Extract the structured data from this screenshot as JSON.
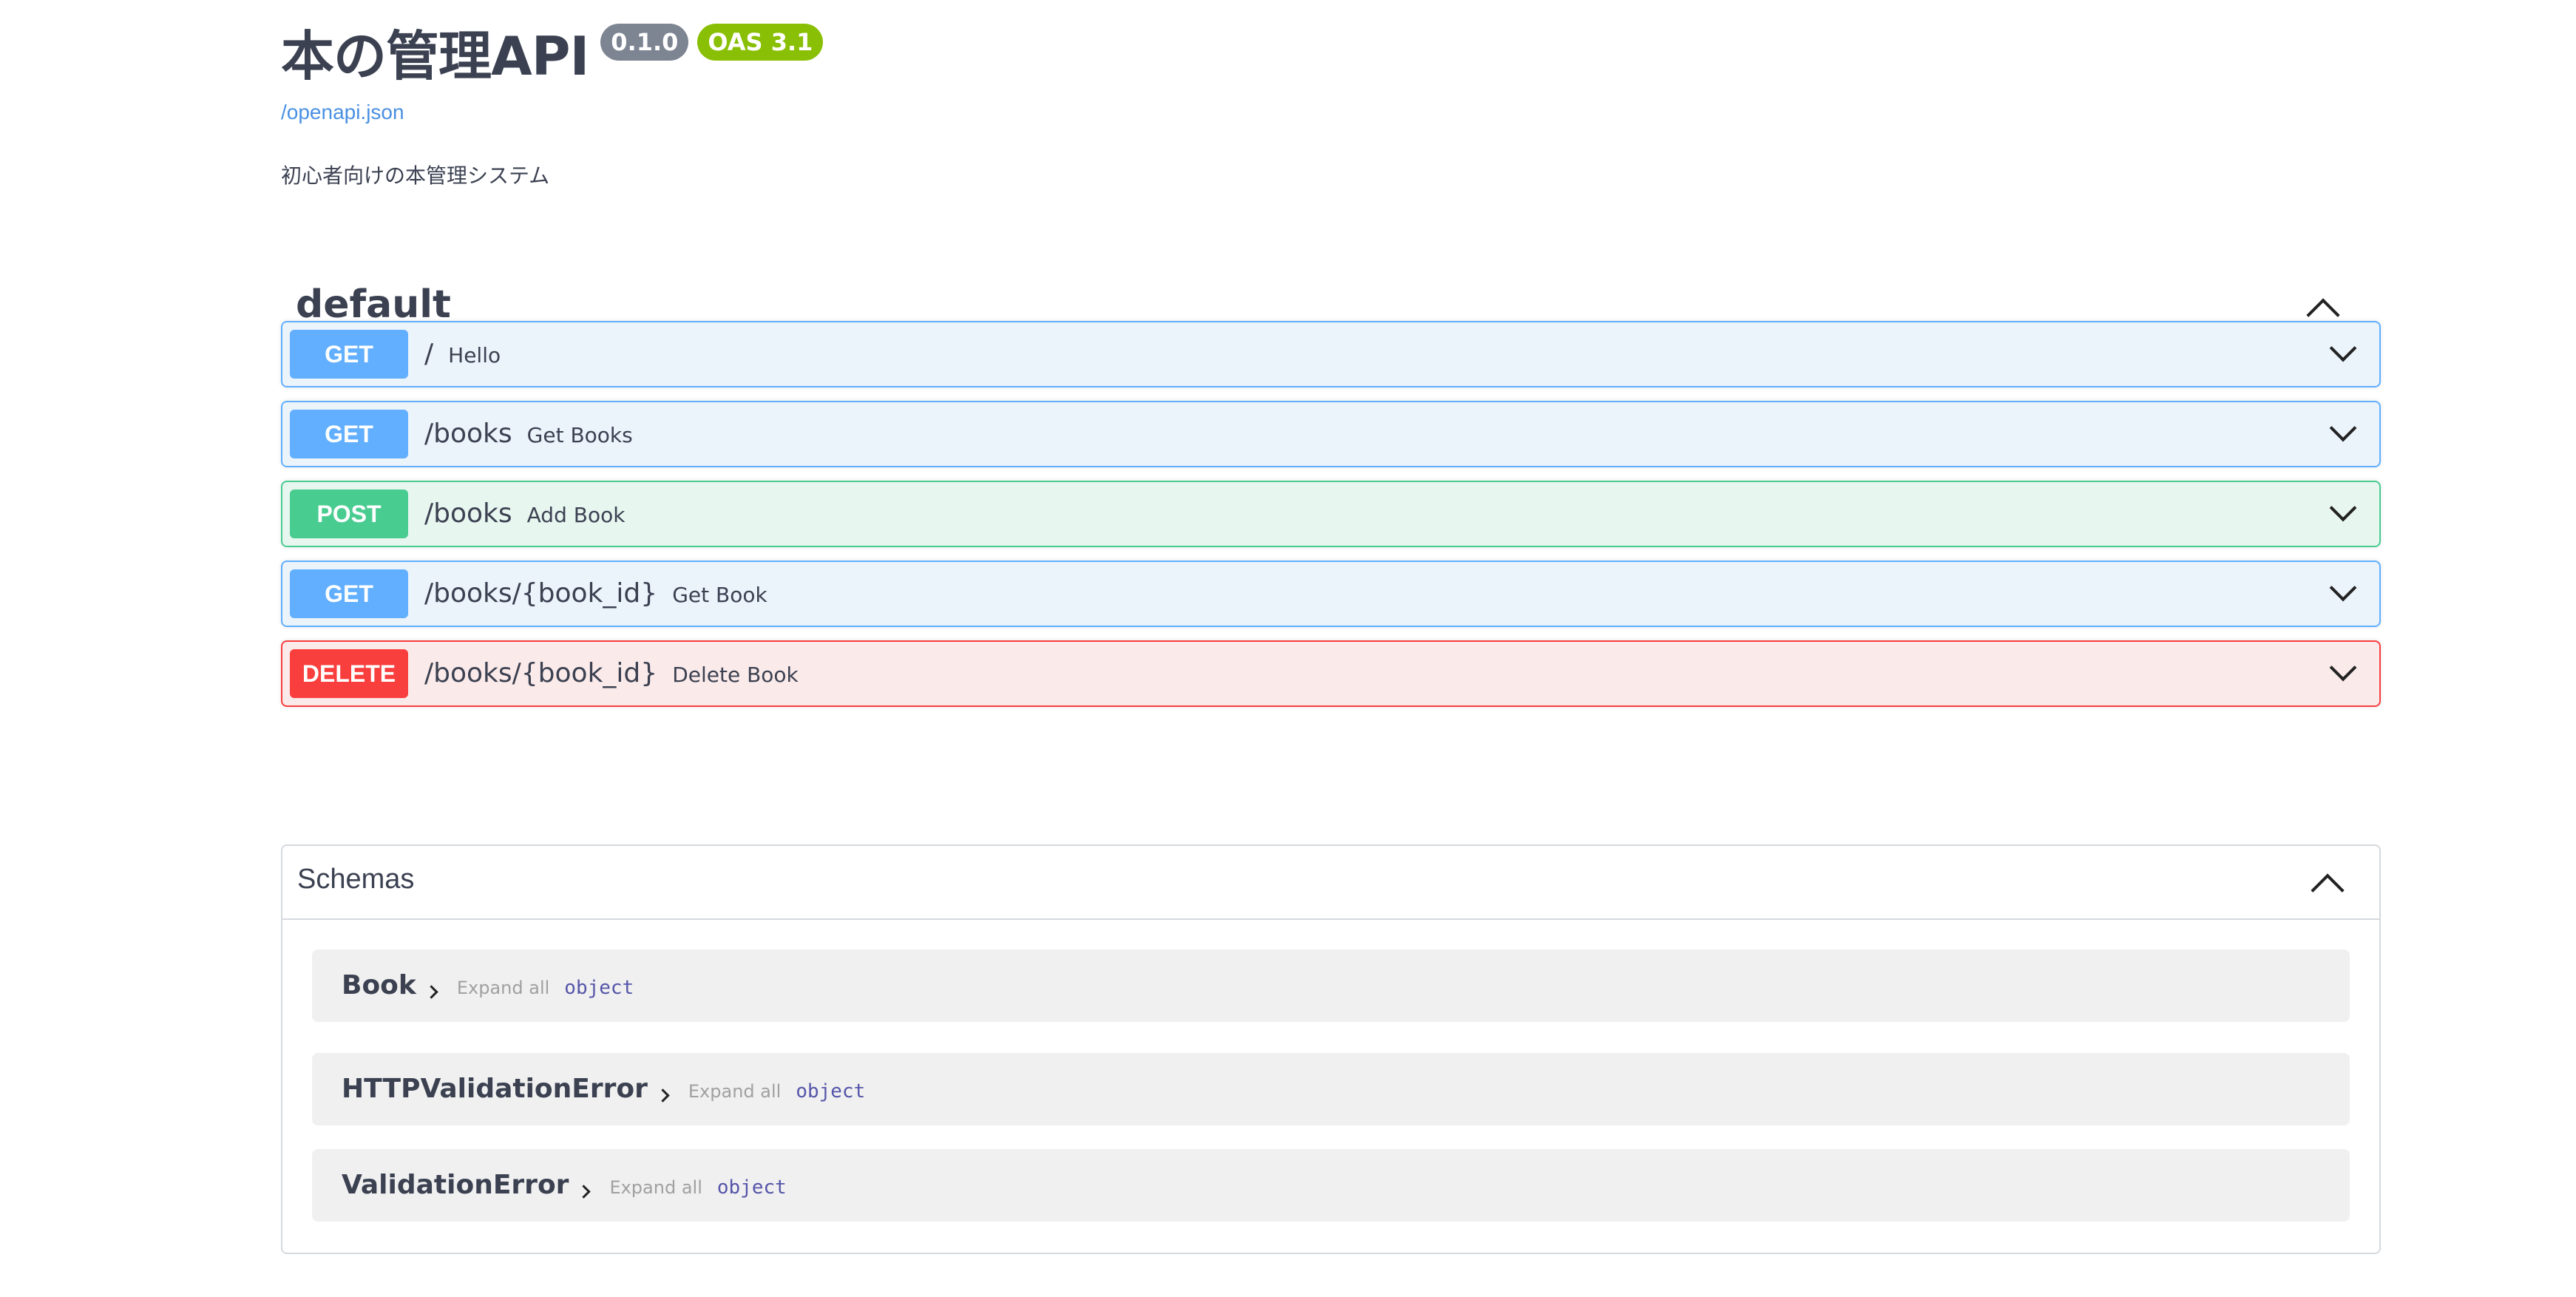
{
  "info": {
    "title": "本の管理API",
    "version": "0.1.0",
    "oas": "OAS 3.1",
    "spec_link": "/openapi.json",
    "description": "初心者向けの本管理システム"
  },
  "tag": {
    "name": "default"
  },
  "operations": [
    {
      "method": "GET",
      "path": "/",
      "summary": "Hello"
    },
    {
      "method": "GET",
      "path": "/books",
      "summary": "Get Books"
    },
    {
      "method": "POST",
      "path": "/books",
      "summary": "Add Book"
    },
    {
      "method": "GET",
      "path": "/books/{book_id}",
      "summary": "Get Book"
    },
    {
      "method": "DELETE",
      "path": "/books/{book_id}",
      "summary": "Delete Book"
    }
  ],
  "schemas": {
    "title": "Schemas",
    "models": [
      {
        "name": "Book",
        "expand_label": "Expand all",
        "type": "object"
      },
      {
        "name": "HTTPValidationError",
        "expand_label": "Expand all",
        "type": "object"
      },
      {
        "name": "ValidationError",
        "expand_label": "Expand all",
        "type": "object"
      }
    ]
  },
  "colors": {
    "get": "#61affe",
    "post": "#49cc90",
    "delete": "#f93e3e",
    "version_badge": "#7d8492",
    "oas_badge": "#89bf04",
    "link": "#4990e2"
  }
}
